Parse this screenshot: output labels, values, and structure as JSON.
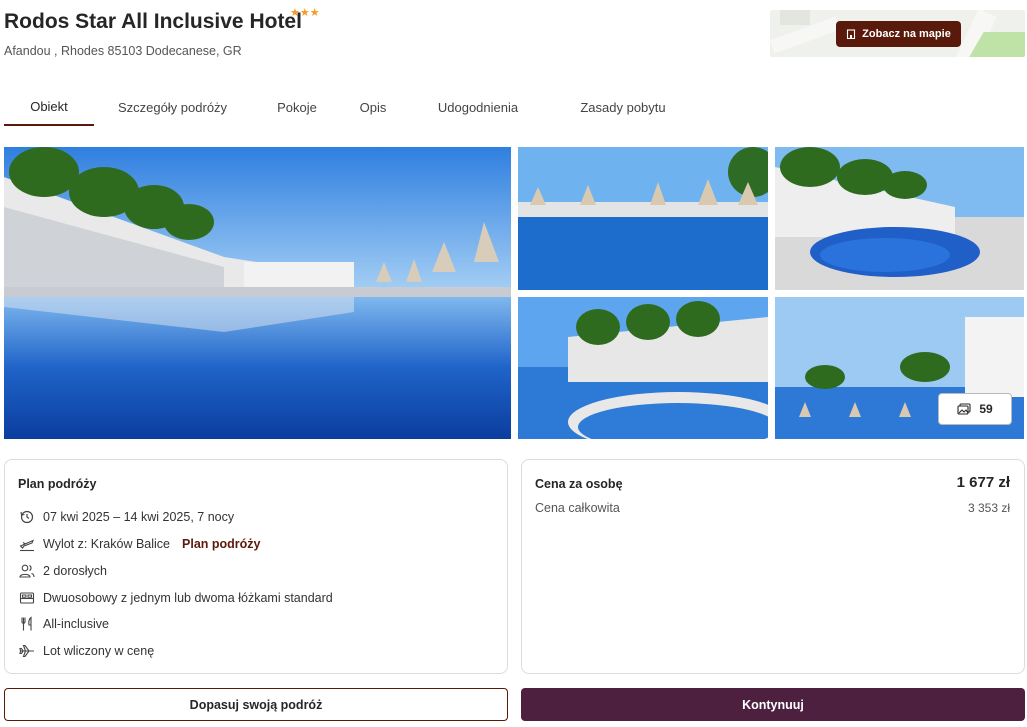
{
  "hotel": {
    "name": "Rodos Star All Inclusive Hotel",
    "stars": "★★★",
    "address": "Afandou , Rhodes 85103 Dodecanese, GR"
  },
  "map": {
    "button_label": "Zobacz na mapie",
    "icon": "building-icon"
  },
  "tabs": [
    {
      "label": "Obiekt",
      "active": true
    },
    {
      "label": "Szczegóły podróży"
    },
    {
      "label": "Pokoje"
    },
    {
      "label": "Opis"
    },
    {
      "label": "Udogodnienia"
    },
    {
      "label": "Zasady pobytu"
    }
  ],
  "gallery": {
    "photo_count": "59",
    "icon": "photos-icon"
  },
  "plan": {
    "title": "Plan podróży",
    "dates": "07 kwi 2025 – 14 kwi 2025, 7 nocy",
    "departure": "Wylot z: Kraków Balice",
    "departure_link": "Plan podróży",
    "travelers": "2 dorosłych",
    "room": "Dwuosobowy z jednym lub dwoma łóżkami standard",
    "board": "All-inclusive",
    "flight": "Lot wliczony w cenę"
  },
  "price": {
    "per_person_label": "Cena za osobę",
    "per_person_value": "1 677 zł",
    "total_label": "Cena całkowita",
    "total_value": "3 353 zł"
  },
  "actions": {
    "customize_label": "Dopasuj swoją podróż",
    "continue_label": "Kontynuuj"
  },
  "colors": {
    "brand": "#5a1a0b",
    "primary_button": "#4e2040",
    "stars": "#f59a23"
  }
}
